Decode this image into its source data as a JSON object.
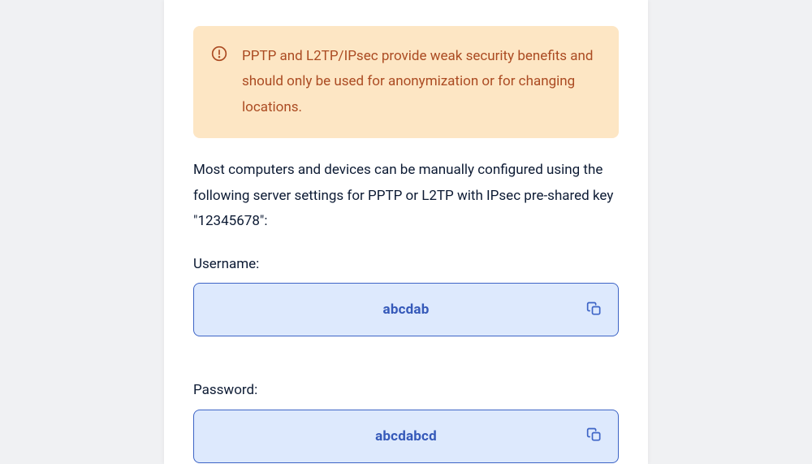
{
  "alert": {
    "text": "PPTP and L2TP/IPsec provide weak security benefits and should only be used for anonymization or for changing locations."
  },
  "description": "Most computers and devices can be manually configured using the following server settings for PPTP or L2TP with IPsec pre-shared key \"12345678\":",
  "username": {
    "label": "Username:",
    "value": "abcdab"
  },
  "password": {
    "label": "Password:",
    "value": "abcdabcd"
  }
}
